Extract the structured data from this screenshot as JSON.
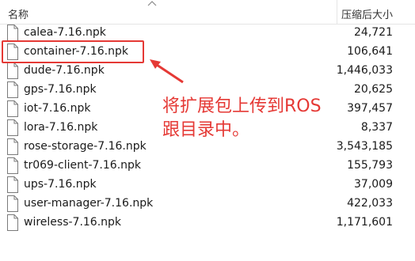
{
  "header": {
    "name_label": "名称",
    "size_label": "压缩后大小"
  },
  "files": [
    {
      "name": "calea-7.16.npk",
      "size": "24,721"
    },
    {
      "name": "container-7.16.npk",
      "size": "106,641"
    },
    {
      "name": "dude-7.16.npk",
      "size": "1,446,033"
    },
    {
      "name": "gps-7.16.npk",
      "size": "20,625"
    },
    {
      "name": "iot-7.16.npk",
      "size": "397,457"
    },
    {
      "name": "lora-7.16.npk",
      "size": "8,337"
    },
    {
      "name": "rose-storage-7.16.npk",
      "size": "3,543,185"
    },
    {
      "name": "tr069-client-7.16.npk",
      "size": "155,793"
    },
    {
      "name": "ups-7.16.npk",
      "size": "37,009"
    },
    {
      "name": "user-manager-7.16.npk",
      "size": "422,033"
    },
    {
      "name": "wireless-7.16.npk",
      "size": "1,171,601"
    }
  ],
  "annotation": {
    "line1": "将扩展包上传到ROS",
    "line2": "跟目录中。"
  },
  "colors": {
    "annotation": "#e53935",
    "highlight_border": "#e53935"
  },
  "icons": {
    "file": "file-icon",
    "sort": "sort-up-icon",
    "arrow": "annotation-arrow-icon"
  }
}
